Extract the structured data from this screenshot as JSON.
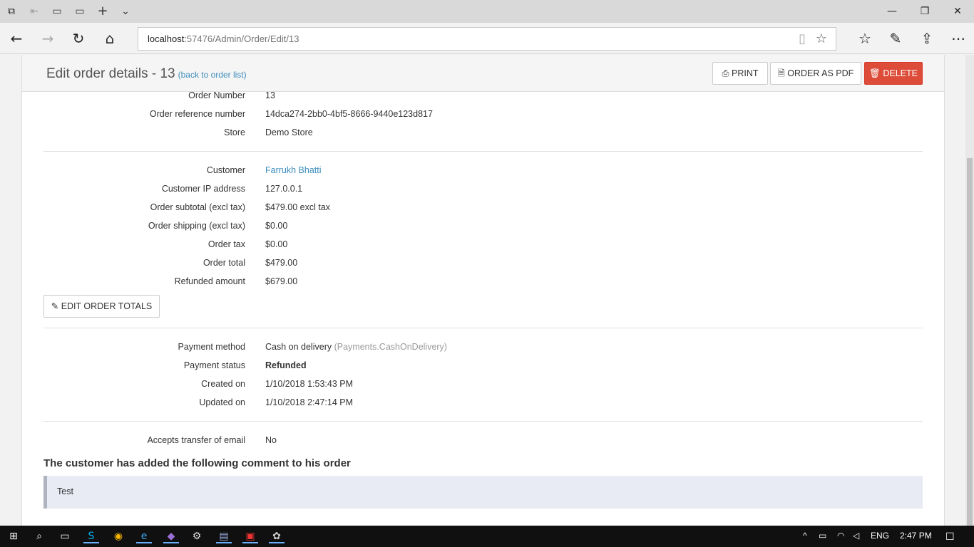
{
  "browser": {
    "url_host": "localhost",
    "url_path": ":57476/Admin/Order/Edit/13"
  },
  "header": {
    "title": "Edit order details - 13",
    "back_link": "(back to order list)",
    "print_label": "PRINT",
    "pdf_label": "ORDER AS PDF",
    "delete_label": "DELETE"
  },
  "info": {
    "order_number_label": "Order Number",
    "order_number": "13",
    "ref_label": "Order reference number",
    "ref": "14dca274-2bb0-4bf5-8666-9440e123d817",
    "store_label": "Store",
    "store": "Demo Store",
    "customer_label": "Customer",
    "customer": "Farrukh Bhatti",
    "ip_label": "Customer IP address",
    "ip": "127.0.0.1",
    "subtotal_label": "Order subtotal (excl tax)",
    "subtotal": "$479.00 excl tax",
    "shipping_label": "Order shipping (excl tax)",
    "shipping": "$0.00",
    "tax_label": "Order tax",
    "tax": "$0.00",
    "total_label": "Order total",
    "total": "$479.00",
    "refunded_label": "Refunded amount",
    "refunded": "$679.00",
    "edit_totals_label": "EDIT ORDER TOTALS",
    "payment_method_label": "Payment method",
    "payment_method": "Cash on delivery",
    "payment_method_sys": "(Payments.CashOnDelivery)",
    "payment_status_label": "Payment status",
    "payment_status": "Refunded",
    "created_label": "Created on",
    "created": "1/10/2018 1:53:43 PM",
    "updated_label": "Updated on",
    "updated": "1/10/2018 2:47:14 PM",
    "email_label": "Accepts transfer of email",
    "email": "No"
  },
  "comment": {
    "heading": "The customer has added the following comment to his order",
    "text": "Test"
  },
  "taskbar": {
    "lang": "ENG",
    "time": "2:47 PM"
  }
}
